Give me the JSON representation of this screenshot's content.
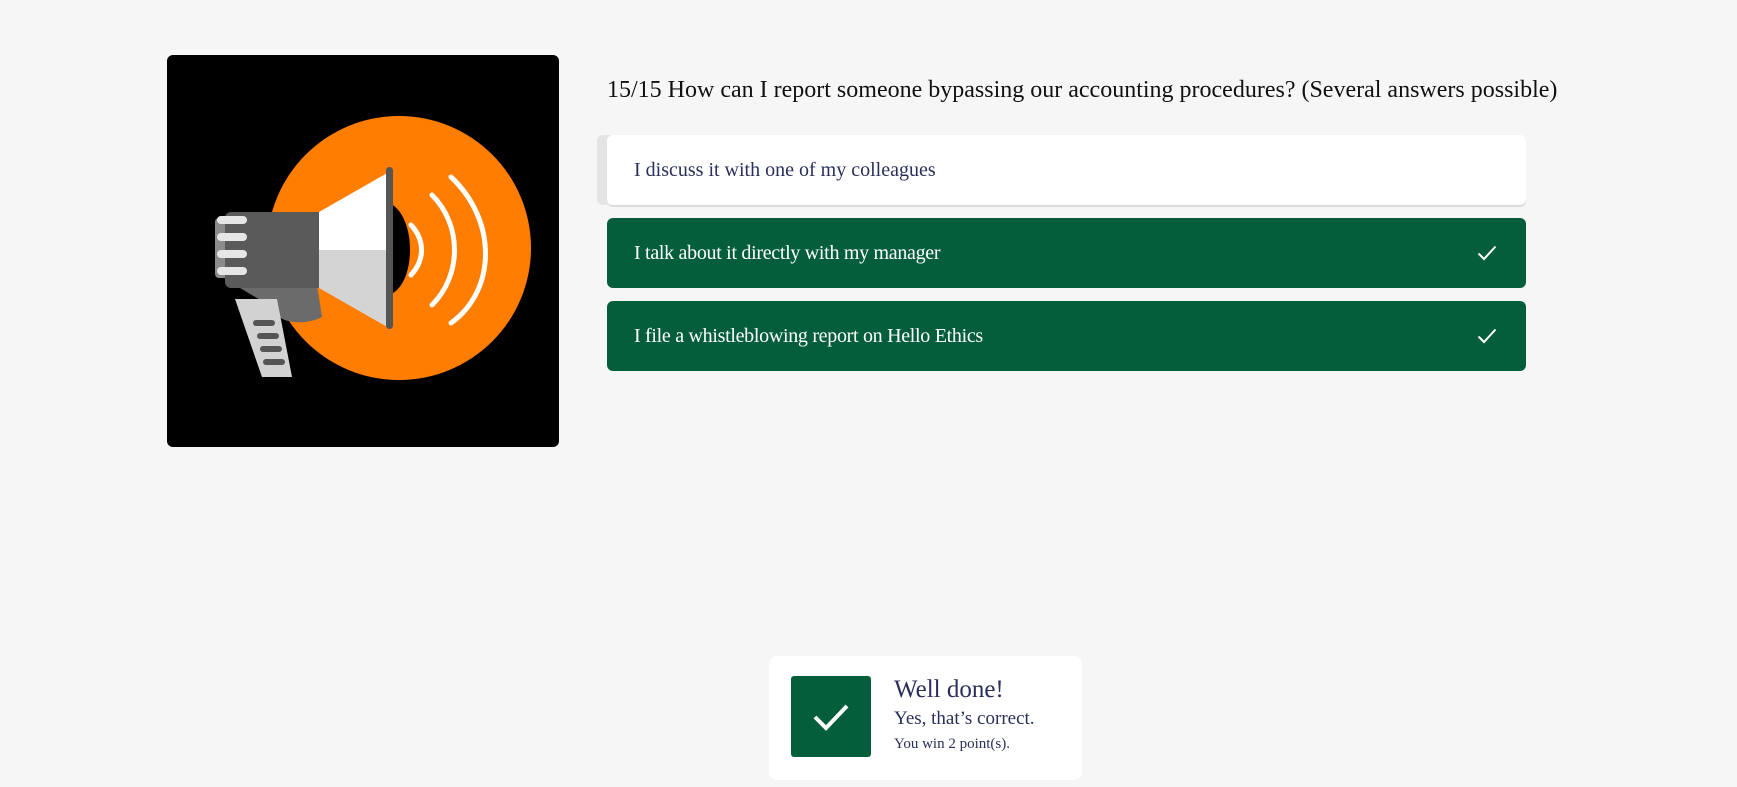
{
  "question": {
    "text": "15/15 How can I report someone bypassing our accounting procedures? (Several answers possible)"
  },
  "answers": [
    {
      "label": "I discuss it with one of my colleagues",
      "selected": false
    },
    {
      "label": "I talk about it directly with my manager",
      "selected": true
    },
    {
      "label": "I file a whistleblowing report on Hello Ethics",
      "selected": true
    }
  ],
  "feedback": {
    "title": "Well done!",
    "subtitle": "Yes, that’s correct.",
    "points": "You win 2 point(s)."
  },
  "illustration": {
    "icon": "megaphone-icon",
    "background_color": "#000000",
    "circle_color": "#ff7d00"
  },
  "colors": {
    "selected_answer": "#055e3b",
    "answer_text": "#2a2f5a",
    "page_background": "#f6f6f6"
  }
}
